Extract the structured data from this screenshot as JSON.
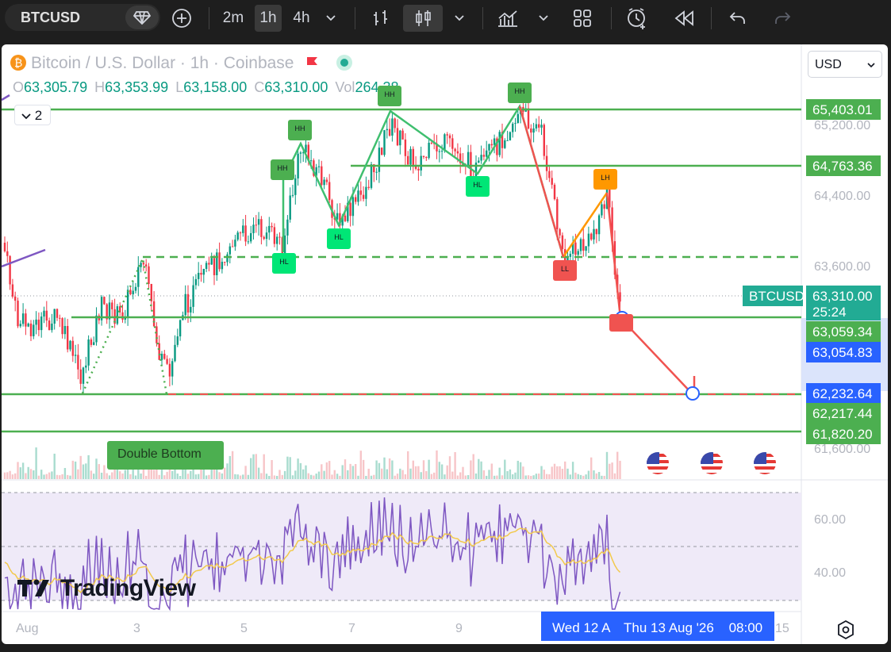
{
  "toolbar": {
    "symbol": "BTCUSD",
    "intervals": [
      "2m",
      "1h",
      "4h"
    ],
    "active_interval": "1h"
  },
  "header": {
    "title": "Bitcoin / U.S. Dollar · 1h · Coinbase",
    "open_label": "O",
    "open": "63,305.79",
    "high_label": "H",
    "high": "63,353.99",
    "low_label": "L",
    "low": "63,158.00",
    "close_label": "C",
    "close": "63,310.00",
    "vol_label": "Vol",
    "vol": "264.38",
    "indicator_count": "2",
    "currency": "USD"
  },
  "price_axis": {
    "ticks": [
      "65,200.00",
      "64,400.00",
      "63,600.00",
      "61,600.00"
    ],
    "tags": [
      {
        "label": "65,403.01",
        "color": "#4caf50"
      },
      {
        "label": "64,763.36",
        "color": "#4caf50"
      },
      {
        "label": "63,310.00",
        "color": "#22ab94"
      },
      {
        "label": "25:24",
        "color": "#22ab94"
      },
      {
        "label": "63,059.34",
        "color": "#4caf50"
      },
      {
        "label": "63,054.83",
        "color": "#2962ff"
      },
      {
        "label": "62,232.64",
        "color": "#2962ff"
      },
      {
        "label": "62,217.44",
        "color": "#4caf50"
      },
      {
        "label": "61,820.20",
        "color": "#4caf50"
      }
    ],
    "symbol_tag": "BTCUSD"
  },
  "rsi_axis": {
    "ticks": [
      "60.00",
      "40.00"
    ]
  },
  "patterns": [
    {
      "label": "HH",
      "color": "#4caf50"
    },
    {
      "label": "HH",
      "color": "#4caf50"
    },
    {
      "label": "HH",
      "color": "#4caf50"
    },
    {
      "label": "HH",
      "color": "#4caf50"
    },
    {
      "label": "HL",
      "color": "#00e676"
    },
    {
      "label": "HL",
      "color": "#00e676"
    },
    {
      "label": "HL",
      "color": "#00e676"
    },
    {
      "label": "LL",
      "color": "#f05350"
    },
    {
      "label": "LH",
      "color": "#ff9800"
    }
  ],
  "annotation": "Double Bottom",
  "brand": "TradingView",
  "time_axis": {
    "ticks": [
      "Aug",
      "3",
      "5",
      "7",
      "9",
      "15"
    ],
    "crosshair_dates": [
      "Wed 12 A",
      "Thu 13 Aug '26",
      "08:00"
    ]
  }
}
